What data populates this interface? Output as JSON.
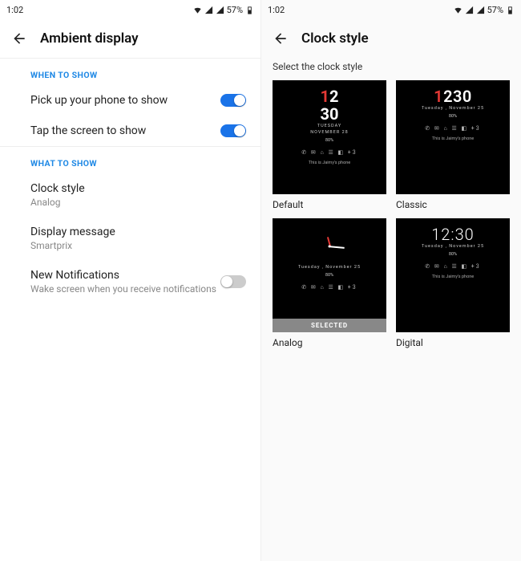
{
  "status": {
    "time": "1:02",
    "battery": "57%"
  },
  "left": {
    "title": "Ambient display",
    "sections": {
      "when": "WHEN TO SHOW",
      "what": "WHAT TO SHOW"
    },
    "pickup": "Pick up your phone to show",
    "tap": "Tap the screen to show",
    "clock": {
      "label": "Clock style",
      "value": "Analog"
    },
    "message": {
      "label": "Display message",
      "value": "Smartprix"
    },
    "notif": {
      "label": "New Notifications",
      "sub": "Wake screen when you receive notifications"
    }
  },
  "right": {
    "title": "Clock style",
    "prompt": "Select the clock style",
    "tiles": {
      "default": "Default",
      "classic": "Classic",
      "analog": "Analog",
      "digital": "Digital",
      "selected": "SELECTED"
    },
    "preview": {
      "time_digital": "12:30",
      "time_classic_red": "1",
      "time_classic_rest": "230",
      "time_default_first": "12",
      "time_default_second": "30",
      "day": "TUESDAY",
      "date_caps": "NOVEMBER 28",
      "date_mixed": "Tuesday , November  25",
      "battery": "80%",
      "icons": "✆  ✉  ⌂  ☰  ◧  +3",
      "owner": "This is Jaimy's phone"
    }
  }
}
